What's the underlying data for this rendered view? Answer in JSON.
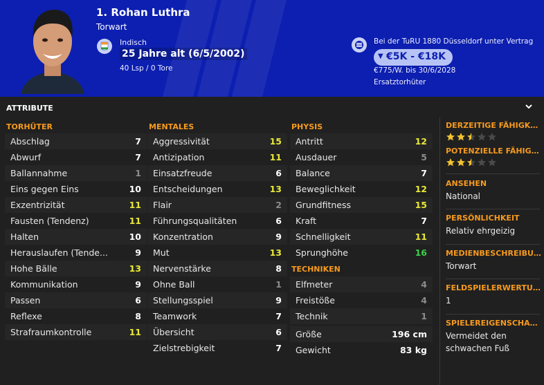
{
  "header": {
    "player_title": "1. Rohan Luthra",
    "position": "Torwart",
    "nationality": "Indisch",
    "age": "25 Jahre alt (6/5/2002)",
    "appearances": "40 Lsp / 0 Tore",
    "contract": "Bei der TuRU 1880 Düsseldorf unter Vertrag",
    "value": "€5K - €18K",
    "wage": "€775/W. bis 30/6/2028",
    "squad_status": "Ersatztorhüter"
  },
  "section": {
    "title": "ATTRIBUTE"
  },
  "columns": [
    {
      "heading": "TORHÜTER",
      "rows": [
        {
          "name": "Abschlag",
          "value": "7",
          "tone": "white"
        },
        {
          "name": "Abwurf",
          "value": "7",
          "tone": "white"
        },
        {
          "name": "Ballannahme",
          "value": "1",
          "tone": "dim"
        },
        {
          "name": "Eins gegen Eins",
          "value": "10",
          "tone": "white"
        },
        {
          "name": "Exzentrizität",
          "value": "11",
          "tone": "yellow"
        },
        {
          "name": "Fausten (Tendenz)",
          "value": "11",
          "tone": "yellow"
        },
        {
          "name": "Halten",
          "value": "10",
          "tone": "white"
        },
        {
          "name": "Herauslaufen (Tende...",
          "value": "9",
          "tone": "white"
        },
        {
          "name": "Hohe Bälle",
          "value": "13",
          "tone": "yellow"
        },
        {
          "name": "Kommunikation",
          "value": "9",
          "tone": "white"
        },
        {
          "name": "Passen",
          "value": "6",
          "tone": "white"
        },
        {
          "name": "Reflexe",
          "value": "8",
          "tone": "white"
        },
        {
          "name": "Strafraumkontrolle",
          "value": "11",
          "tone": "yellow"
        }
      ]
    },
    {
      "heading": "MENTALES",
      "rows": [
        {
          "name": "Aggressivität",
          "value": "15",
          "tone": "yellow"
        },
        {
          "name": "Antizipation",
          "value": "11",
          "tone": "yellow"
        },
        {
          "name": "Einsatzfreude",
          "value": "6",
          "tone": "white"
        },
        {
          "name": "Entscheidungen",
          "value": "13",
          "tone": "yellow"
        },
        {
          "name": "Flair",
          "value": "2",
          "tone": "dim"
        },
        {
          "name": "Führungsqualitäten",
          "value": "6",
          "tone": "white"
        },
        {
          "name": "Konzentration",
          "value": "9",
          "tone": "white"
        },
        {
          "name": "Mut",
          "value": "13",
          "tone": "yellow"
        },
        {
          "name": "Nervenstärke",
          "value": "8",
          "tone": "white"
        },
        {
          "name": "Ohne Ball",
          "value": "1",
          "tone": "dim"
        },
        {
          "name": "Stellungsspiel",
          "value": "9",
          "tone": "white"
        },
        {
          "name": "Teamwork",
          "value": "7",
          "tone": "white"
        },
        {
          "name": "Übersicht",
          "value": "6",
          "tone": "white"
        },
        {
          "name": "Zielstrebigkeit",
          "value": "7",
          "tone": "white"
        }
      ]
    },
    {
      "heading": "PHYSIS",
      "rows": [
        {
          "name": "Antritt",
          "value": "12",
          "tone": "yellow"
        },
        {
          "name": "Ausdauer",
          "value": "5",
          "tone": "dim"
        },
        {
          "name": "Balance",
          "value": "7",
          "tone": "white"
        },
        {
          "name": "Beweglichkeit",
          "value": "12",
          "tone": "yellow"
        },
        {
          "name": "Grundfitness",
          "value": "15",
          "tone": "yellow"
        },
        {
          "name": "Kraft",
          "value": "7",
          "tone": "white"
        },
        {
          "name": "Schnelligkeit",
          "value": "11",
          "tone": "yellow"
        },
        {
          "name": "Sprunghöhe",
          "value": "16",
          "tone": "green"
        }
      ],
      "subheading": "TECHNIKEN",
      "subrows": [
        {
          "name": "Elfmeter",
          "value": "4",
          "tone": "dim"
        },
        {
          "name": "Freistöße",
          "value": "4",
          "tone": "dim"
        },
        {
          "name": "Technik",
          "value": "1",
          "tone": "dim"
        }
      ],
      "measures": [
        {
          "name": "Größe",
          "value": "196 cm"
        },
        {
          "name": "Gewicht",
          "value": "83 kg"
        }
      ]
    }
  ],
  "side": {
    "current_ability_label": "DERZEITIGE FÄHIGKEIT",
    "current_ability_stars": 2.5,
    "potential_ability_label": "POTENZIELLE FÄHIGKEIT",
    "potential_ability_stars": 2.5,
    "reputation_label": "ANSEHEN",
    "reputation_value": "National",
    "personality_label": "PERSÖNLICHKEIT",
    "personality_value": "Relativ ehrgeizig",
    "media_label": "MEDIENBESCHREIBUNG",
    "media_value": "Torwart",
    "outfield_label": "FELDSPIELERWERTUNG",
    "outfield_value": "1",
    "traits_label": "SPIELEREIGENSCHAFTEN",
    "traits_value": "Vermeidet den schwachen Fuß"
  },
  "colors": {
    "header_bg": "#0c1fb0",
    "accent_orange": "#f79a1f",
    "value_yellow": "#e8e838",
    "value_green": "#3cd04a",
    "star_gold": "#f2c230"
  },
  "icons": [
    "india-flag-icon",
    "club-crest-icon",
    "down-arrow-icon",
    "chevron-down-icon",
    "star-icon"
  ]
}
